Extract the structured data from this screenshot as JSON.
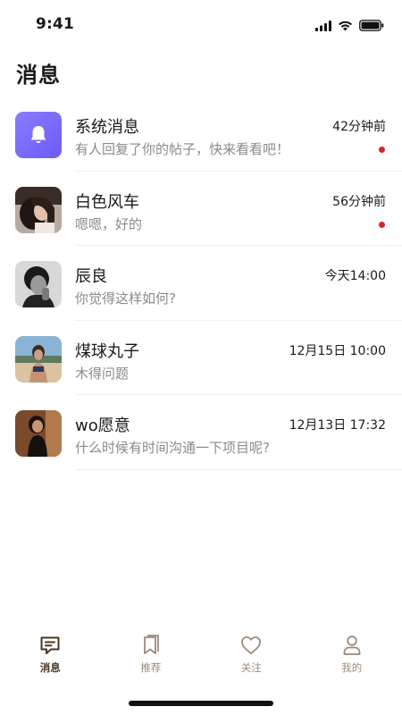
{
  "status_bar": {
    "time": "9:41"
  },
  "page": {
    "title": "消息"
  },
  "messages": [
    {
      "name": "系统消息",
      "preview": "有人回复了你的帖子，快来看看吧！",
      "time": "42分钟前",
      "unread": true,
      "avatar": "bell-icon"
    },
    {
      "name": "白色风车",
      "preview": "嗯嗯，好的",
      "time": "56分钟前",
      "unread": true,
      "avatar": "photo"
    },
    {
      "name": "辰良",
      "preview": "你觉得这样如何?",
      "time": "今天14:00",
      "unread": false,
      "avatar": "photo"
    },
    {
      "name": "煤球丸子",
      "preview": "木得问题",
      "time": "12月15日 10:00",
      "unread": false,
      "avatar": "photo"
    },
    {
      "name": "wo愿意",
      "preview": "什么时候有时间沟通一下项目呢?",
      "time": "12月13日 17:32",
      "unread": false,
      "avatar": "photo"
    }
  ],
  "tab_bar": {
    "tabs": [
      {
        "label": "消息",
        "icon": "message-icon",
        "active": true
      },
      {
        "label": "推荐",
        "icon": "bookmark-icon",
        "active": false
      },
      {
        "label": "关注",
        "icon": "heart-icon",
        "active": false
      },
      {
        "label": "我的",
        "icon": "user-icon",
        "active": false
      }
    ]
  },
  "colors": {
    "unread_dot": "#d9262b",
    "tab_active": "#4b3520",
    "tab_inactive": "#9a8a78",
    "system_avatar": "#7b6cf8"
  }
}
